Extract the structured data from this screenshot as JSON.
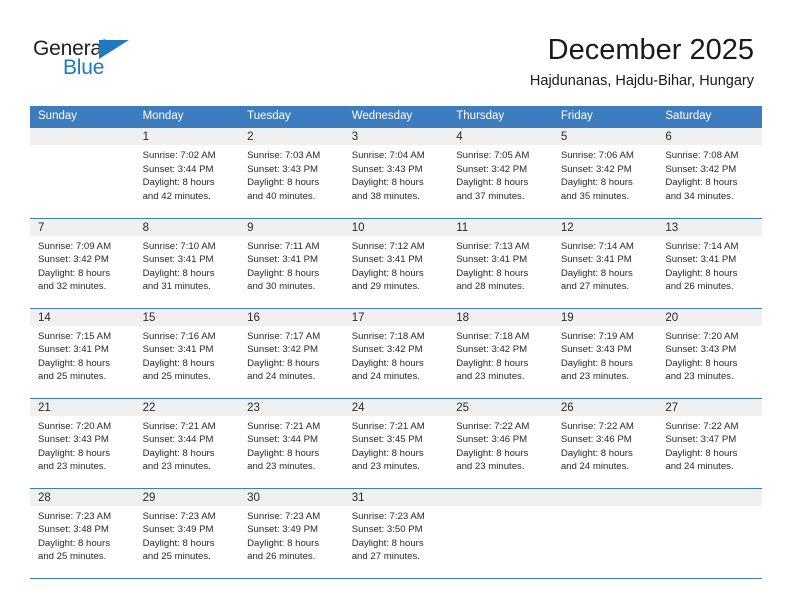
{
  "brand": {
    "name_top": "General",
    "name_bottom": "Blue",
    "color_primary": "#1f7bc1",
    "color_text": "#231f20"
  },
  "header": {
    "title": "December 2025",
    "subtitle": "Hajdunanas, Hajdu-Bihar, Hungary"
  },
  "theme": {
    "header_row_bg": "#3c7cbf",
    "daynum_bg": "#f0f0f0",
    "row_border": "#3c7cbf",
    "text": "#2a2a2a"
  },
  "weekday_headers": [
    "Sunday",
    "Monday",
    "Tuesday",
    "Wednesday",
    "Thursday",
    "Friday",
    "Saturday"
  ],
  "weeks": [
    [
      {
        "day": "",
        "sunrise": "",
        "sunset": "",
        "daylight_1": "",
        "daylight_2": "",
        "blank": true
      },
      {
        "day": "1",
        "sunrise": "Sunrise: 7:02 AM",
        "sunset": "Sunset: 3:44 PM",
        "daylight_1": "Daylight: 8 hours",
        "daylight_2": "and 42 minutes."
      },
      {
        "day": "2",
        "sunrise": "Sunrise: 7:03 AM",
        "sunset": "Sunset: 3:43 PM",
        "daylight_1": "Daylight: 8 hours",
        "daylight_2": "and 40 minutes."
      },
      {
        "day": "3",
        "sunrise": "Sunrise: 7:04 AM",
        "sunset": "Sunset: 3:43 PM",
        "daylight_1": "Daylight: 8 hours",
        "daylight_2": "and 38 minutes."
      },
      {
        "day": "4",
        "sunrise": "Sunrise: 7:05 AM",
        "sunset": "Sunset: 3:42 PM",
        "daylight_1": "Daylight: 8 hours",
        "daylight_2": "and 37 minutes."
      },
      {
        "day": "5",
        "sunrise": "Sunrise: 7:06 AM",
        "sunset": "Sunset: 3:42 PM",
        "daylight_1": "Daylight: 8 hours",
        "daylight_2": "and 35 minutes."
      },
      {
        "day": "6",
        "sunrise": "Sunrise: 7:08 AM",
        "sunset": "Sunset: 3:42 PM",
        "daylight_1": "Daylight: 8 hours",
        "daylight_2": "and 34 minutes."
      }
    ],
    [
      {
        "day": "7",
        "sunrise": "Sunrise: 7:09 AM",
        "sunset": "Sunset: 3:42 PM",
        "daylight_1": "Daylight: 8 hours",
        "daylight_2": "and 32 minutes."
      },
      {
        "day": "8",
        "sunrise": "Sunrise: 7:10 AM",
        "sunset": "Sunset: 3:41 PM",
        "daylight_1": "Daylight: 8 hours",
        "daylight_2": "and 31 minutes."
      },
      {
        "day": "9",
        "sunrise": "Sunrise: 7:11 AM",
        "sunset": "Sunset: 3:41 PM",
        "daylight_1": "Daylight: 8 hours",
        "daylight_2": "and 30 minutes."
      },
      {
        "day": "10",
        "sunrise": "Sunrise: 7:12 AM",
        "sunset": "Sunset: 3:41 PM",
        "daylight_1": "Daylight: 8 hours",
        "daylight_2": "and 29 minutes."
      },
      {
        "day": "11",
        "sunrise": "Sunrise: 7:13 AM",
        "sunset": "Sunset: 3:41 PM",
        "daylight_1": "Daylight: 8 hours",
        "daylight_2": "and 28 minutes."
      },
      {
        "day": "12",
        "sunrise": "Sunrise: 7:14 AM",
        "sunset": "Sunset: 3:41 PM",
        "daylight_1": "Daylight: 8 hours",
        "daylight_2": "and 27 minutes."
      },
      {
        "day": "13",
        "sunrise": "Sunrise: 7:14 AM",
        "sunset": "Sunset: 3:41 PM",
        "daylight_1": "Daylight: 8 hours",
        "daylight_2": "and 26 minutes."
      }
    ],
    [
      {
        "day": "14",
        "sunrise": "Sunrise: 7:15 AM",
        "sunset": "Sunset: 3:41 PM",
        "daylight_1": "Daylight: 8 hours",
        "daylight_2": "and 25 minutes."
      },
      {
        "day": "15",
        "sunrise": "Sunrise: 7:16 AM",
        "sunset": "Sunset: 3:41 PM",
        "daylight_1": "Daylight: 8 hours",
        "daylight_2": "and 25 minutes."
      },
      {
        "day": "16",
        "sunrise": "Sunrise: 7:17 AM",
        "sunset": "Sunset: 3:42 PM",
        "daylight_1": "Daylight: 8 hours",
        "daylight_2": "and 24 minutes."
      },
      {
        "day": "17",
        "sunrise": "Sunrise: 7:18 AM",
        "sunset": "Sunset: 3:42 PM",
        "daylight_1": "Daylight: 8 hours",
        "daylight_2": "and 24 minutes."
      },
      {
        "day": "18",
        "sunrise": "Sunrise: 7:18 AM",
        "sunset": "Sunset: 3:42 PM",
        "daylight_1": "Daylight: 8 hours",
        "daylight_2": "and 23 minutes."
      },
      {
        "day": "19",
        "sunrise": "Sunrise: 7:19 AM",
        "sunset": "Sunset: 3:43 PM",
        "daylight_1": "Daylight: 8 hours",
        "daylight_2": "and 23 minutes."
      },
      {
        "day": "20",
        "sunrise": "Sunrise: 7:20 AM",
        "sunset": "Sunset: 3:43 PM",
        "daylight_1": "Daylight: 8 hours",
        "daylight_2": "and 23 minutes."
      }
    ],
    [
      {
        "day": "21",
        "sunrise": "Sunrise: 7:20 AM",
        "sunset": "Sunset: 3:43 PM",
        "daylight_1": "Daylight: 8 hours",
        "daylight_2": "and 23 minutes."
      },
      {
        "day": "22",
        "sunrise": "Sunrise: 7:21 AM",
        "sunset": "Sunset: 3:44 PM",
        "daylight_1": "Daylight: 8 hours",
        "daylight_2": "and 23 minutes."
      },
      {
        "day": "23",
        "sunrise": "Sunrise: 7:21 AM",
        "sunset": "Sunset: 3:44 PM",
        "daylight_1": "Daylight: 8 hours",
        "daylight_2": "and 23 minutes."
      },
      {
        "day": "24",
        "sunrise": "Sunrise: 7:21 AM",
        "sunset": "Sunset: 3:45 PM",
        "daylight_1": "Daylight: 8 hours",
        "daylight_2": "and 23 minutes."
      },
      {
        "day": "25",
        "sunrise": "Sunrise: 7:22 AM",
        "sunset": "Sunset: 3:46 PM",
        "daylight_1": "Daylight: 8 hours",
        "daylight_2": "and 23 minutes."
      },
      {
        "day": "26",
        "sunrise": "Sunrise: 7:22 AM",
        "sunset": "Sunset: 3:46 PM",
        "daylight_1": "Daylight: 8 hours",
        "daylight_2": "and 24 minutes."
      },
      {
        "day": "27",
        "sunrise": "Sunrise: 7:22 AM",
        "sunset": "Sunset: 3:47 PM",
        "daylight_1": "Daylight: 8 hours",
        "daylight_2": "and 24 minutes."
      }
    ],
    [
      {
        "day": "28",
        "sunrise": "Sunrise: 7:23 AM",
        "sunset": "Sunset: 3:48 PM",
        "daylight_1": "Daylight: 8 hours",
        "daylight_2": "and 25 minutes."
      },
      {
        "day": "29",
        "sunrise": "Sunrise: 7:23 AM",
        "sunset": "Sunset: 3:49 PM",
        "daylight_1": "Daylight: 8 hours",
        "daylight_2": "and 25 minutes."
      },
      {
        "day": "30",
        "sunrise": "Sunrise: 7:23 AM",
        "sunset": "Sunset: 3:49 PM",
        "daylight_1": "Daylight: 8 hours",
        "daylight_2": "and 26 minutes."
      },
      {
        "day": "31",
        "sunrise": "Sunrise: 7:23 AM",
        "sunset": "Sunset: 3:50 PM",
        "daylight_1": "Daylight: 8 hours",
        "daylight_2": "and 27 minutes."
      },
      {
        "day": "",
        "sunrise": "",
        "sunset": "",
        "daylight_1": "",
        "daylight_2": "",
        "blank": true
      },
      {
        "day": "",
        "sunrise": "",
        "sunset": "",
        "daylight_1": "",
        "daylight_2": "",
        "blank": true
      },
      {
        "day": "",
        "sunrise": "",
        "sunset": "",
        "daylight_1": "",
        "daylight_2": "",
        "blank": true
      }
    ]
  ]
}
